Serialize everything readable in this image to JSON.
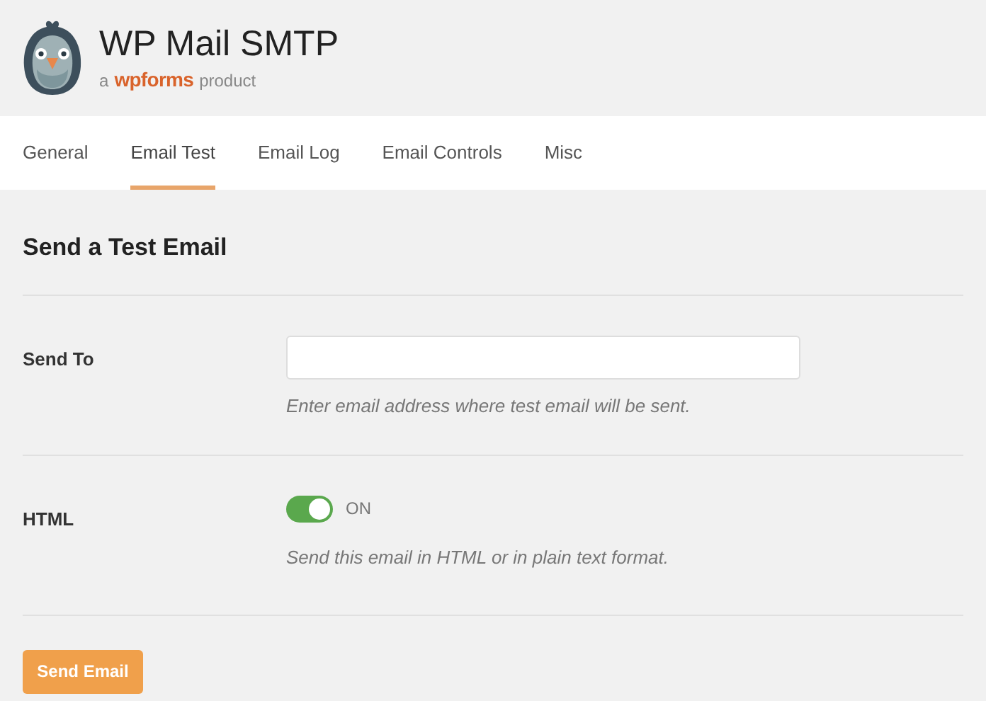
{
  "header": {
    "title": "WP Mail SMTP",
    "tagline": {
      "prefix": "a",
      "brand": "wpforms",
      "suffix": "product"
    }
  },
  "tabs": [
    {
      "label": "General",
      "selected": false
    },
    {
      "label": "Email Test",
      "selected": true
    },
    {
      "label": "Email Log",
      "selected": false
    },
    {
      "label": "Email Controls",
      "selected": false
    },
    {
      "label": "Misc",
      "selected": false
    }
  ],
  "section_title": "Send a Test Email",
  "fields": [
    {
      "kind": "text",
      "label": "Send To",
      "hint": "Enter email address where test email will be sent."
    },
    {
      "kind": "toggle",
      "label": "HTML",
      "on": true,
      "state_label": "ON",
      "hint": "Send this email in HTML or in plain text format."
    }
  ],
  "submit_button": "Send Email"
}
